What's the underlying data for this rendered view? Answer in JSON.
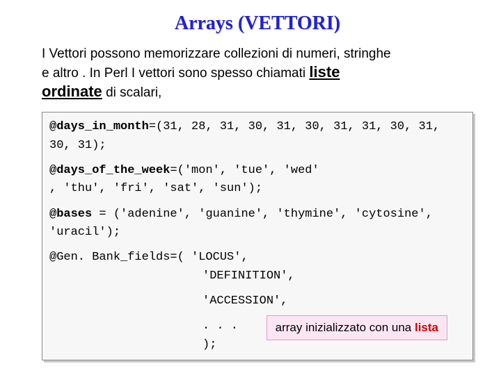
{
  "title": "Arrays (VETTORI)",
  "intro": {
    "line1": "I Vettori possono memorizzare collezioni di numeri, stringhe",
    "line2a": "e altro . In Perl I vettori sono spesso chiamati ",
    "bold1": "liste",
    "bold2": "ordinate",
    "tail": " di scalari,"
  },
  "code": {
    "l1a": "@days_in_month",
    "l1b": "=(31, 28, 31, 30, 31, 30, 31, 31, 30, 31, 30, 31);",
    "l2a": "@days_of_the_week",
    "l2b": "=('mon', 'tue', 'wed'",
    "l2c": ", 'thu', 'fri', 'sat', 'sun');",
    "l3a": "@bases",
    "l3b": " = ('adenine', 'guanine', 'thymine', 'cytosine',",
    "l3c": "'uracil');",
    "l4a": "@Gen. Bank_fields=( 'LOCUS',",
    "l4b": "'DEFINITION',",
    "l4c": "'ACCESSION',",
    "l4d": ". . .",
    "l4e": ");"
  },
  "callout": {
    "t1": "array  inizializzato con una ",
    "t2": "lista"
  }
}
